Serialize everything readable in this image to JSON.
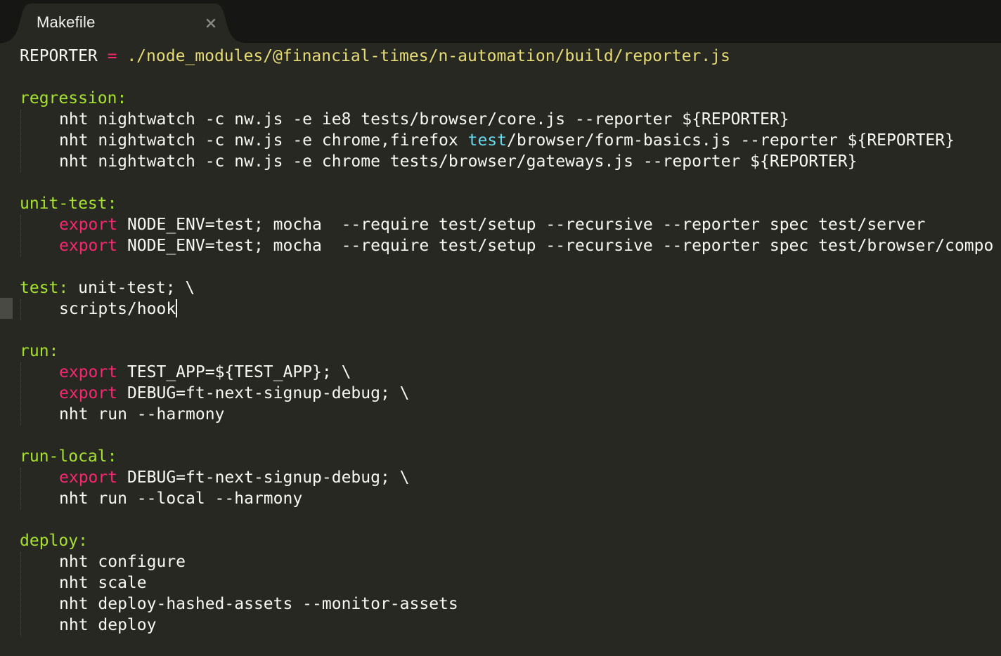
{
  "tab": {
    "title": "Makefile",
    "close_glyph": "×",
    "close_icon": "close-icon"
  },
  "colors": {
    "background": "#272822",
    "tabbar": "#161714",
    "variable": "#f8f8f2",
    "operator": "#f92672",
    "string": "#e6db74",
    "target": "#a6e22e",
    "keyword": "#f92672",
    "builtin": "#66d9ef"
  },
  "code": {
    "reporter_var": "REPORTER",
    "reporter_op": " = ",
    "reporter_path": "./node_modules/@financial-times/n-automation/build/reporter.js",
    "regression_target": "regression:",
    "regression_1": "nht nightwatch -c nw.js -e ie8 tests/browser/core.js --reporter ${REPORTER}",
    "regression_2a": "nht nightwatch -c nw.js -e chrome,firefox ",
    "regression_2b": "test",
    "regression_2c": "/browser/form-basics.js --reporter ${REPORTER}",
    "regression_3": "nht nightwatch -c nw.js -e chrome tests/browser/gateways.js --reporter ${REPORTER}",
    "unit_target": "unit-test:",
    "export_kw": "export",
    "unit_1": " NODE_ENV=test; mocha  --require test/setup --recursive --reporter spec test/server",
    "unit_2": " NODE_ENV=test; mocha  --require test/setup --recursive --reporter spec test/browser/compo",
    "test_target": "test:",
    "test_deps": " unit-test; \\",
    "test_1": "scripts/hook",
    "run_target": "run:",
    "run_1": " TEST_APP=${TEST_APP}; \\",
    "run_2": " DEBUG=ft-next-signup-debug; \\",
    "run_3": "nht run --harmony",
    "runlocal_target": "run-local:",
    "runlocal_1": " DEBUG=ft-next-signup-debug; \\",
    "runlocal_2": "nht run --local --harmony",
    "deploy_target": "deploy:",
    "deploy_1": "nht configure",
    "deploy_2": "nht scale",
    "deploy_3": "nht deploy-hashed-assets --monitor-assets",
    "deploy_4": "nht deploy"
  }
}
